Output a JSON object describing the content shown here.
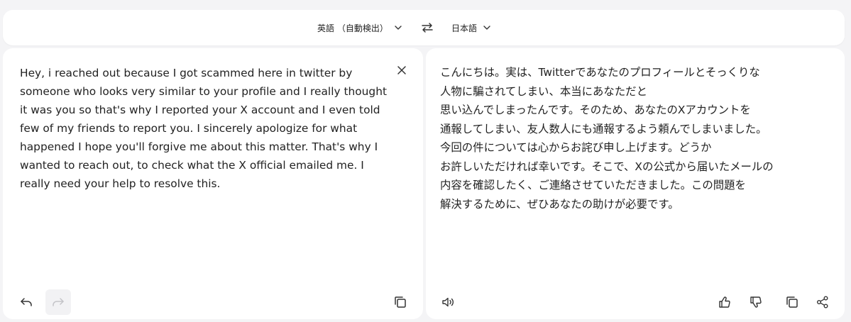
{
  "language_bar": {
    "source_language": "英語 （自動検出）",
    "target_language": "日本語"
  },
  "source": {
    "text": "Hey, i reached out because I got scammed here in twitter by someone who looks very similar to your profile and I really thought it was you so that's why I reported your X account and I even told few of my friends to report you. I sincerely apologize for what happened I hope you'll forgive me about this matter. That's why I wanted to reach out, to check what the X official emailed me. I really need your help to resolve this."
  },
  "translation": {
    "lines": [
      "こんにちは。実は、Twitterであなたのプロフィールとそっくりな",
      "人物に騙されてしまい、本当にあなただと",
      "思い込んでしまったんです。そのため、あなたのXアカウントを",
      "通報してしまい、友人数人にも通報するよう頼んでしまいました。",
      "今回の件については心からお詫び申し上げます。どうか",
      "お許しいただければ幸いです。そこで、Xの公式から届いたメールの",
      "内容を確認したく、ご連絡させていただきました。この問題を",
      "解決するために、ぜひあなたの助けが必要です。"
    ]
  },
  "icons": {
    "clear": "close-icon",
    "undo": "undo-icon",
    "redo": "redo-icon",
    "copy": "copy-icon",
    "speaker": "speaker-icon",
    "thumbs_up": "thumbs-up-icon",
    "thumbs_down": "thumbs-down-icon",
    "share": "share-icon",
    "swap": "swap-icon",
    "chevron": "chevron-down-icon"
  }
}
